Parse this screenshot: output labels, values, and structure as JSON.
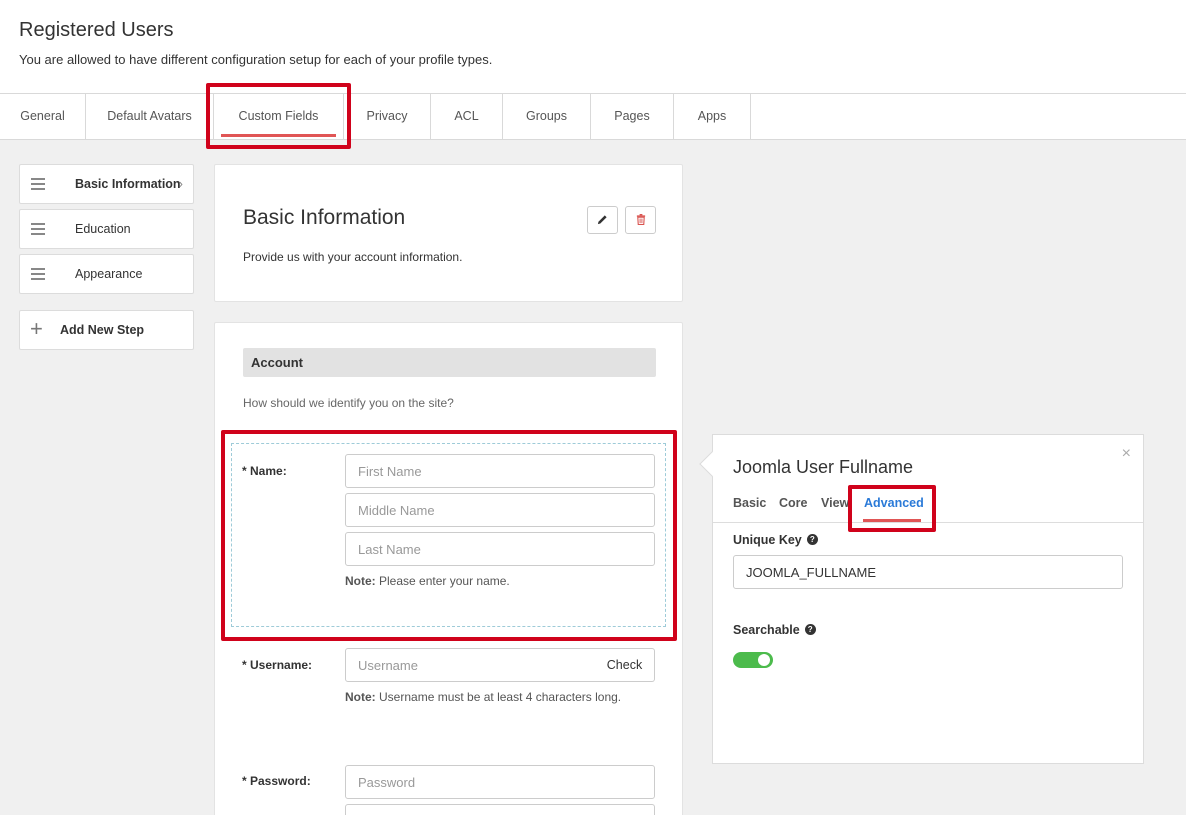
{
  "header": {
    "title": "Registered Users",
    "description": "You are allowed to have different configuration setup for each of your profile types."
  },
  "tabs": [
    {
      "label": "General"
    },
    {
      "label": "Default Avatars"
    },
    {
      "label": "Custom Fields",
      "active": true
    },
    {
      "label": "Privacy"
    },
    {
      "label": "ACL"
    },
    {
      "label": "Groups"
    },
    {
      "label": "Pages"
    },
    {
      "label": "Apps"
    }
  ],
  "steps": [
    {
      "label": "Basic Information",
      "active": true
    },
    {
      "label": "Education"
    },
    {
      "label": "Appearance"
    }
  ],
  "add_step_label": "Add New Step",
  "step_card": {
    "title": "Basic Information",
    "description": "Provide us with your account information.",
    "edit_icon": "pencil-icon",
    "delete_icon": "trash-icon"
  },
  "form": {
    "section_title": "Account",
    "section_description": "How should we identify you on the site?",
    "name": {
      "label": "* Name:",
      "first_placeholder": "First Name",
      "middle_placeholder": "Middle Name",
      "last_placeholder": "Last Name",
      "note_bold": "Note:",
      "note": "Please enter your name."
    },
    "username": {
      "label": "* Username:",
      "placeholder": "Username",
      "check_label": "Check",
      "note_bold": "Note:",
      "note": "Username must be at least 4 characters long."
    },
    "password": {
      "label": "* Password:",
      "placeholder": "Password"
    }
  },
  "panel": {
    "title": "Joomla User Fullname",
    "close": "×",
    "tabs": [
      "Basic",
      "Core",
      "View",
      "Advanced"
    ],
    "active_tab": "Advanced",
    "unique_key_label": "Unique Key",
    "unique_key_value": "JOOMLA_FULLNAME",
    "searchable_label": "Searchable",
    "searchable_on": true
  },
  "colors": {
    "highlight": "#d0021b",
    "active_tab_underline": "#e05555",
    "toggle_on": "#4cbb4c",
    "link_active": "#2a7ad8"
  }
}
